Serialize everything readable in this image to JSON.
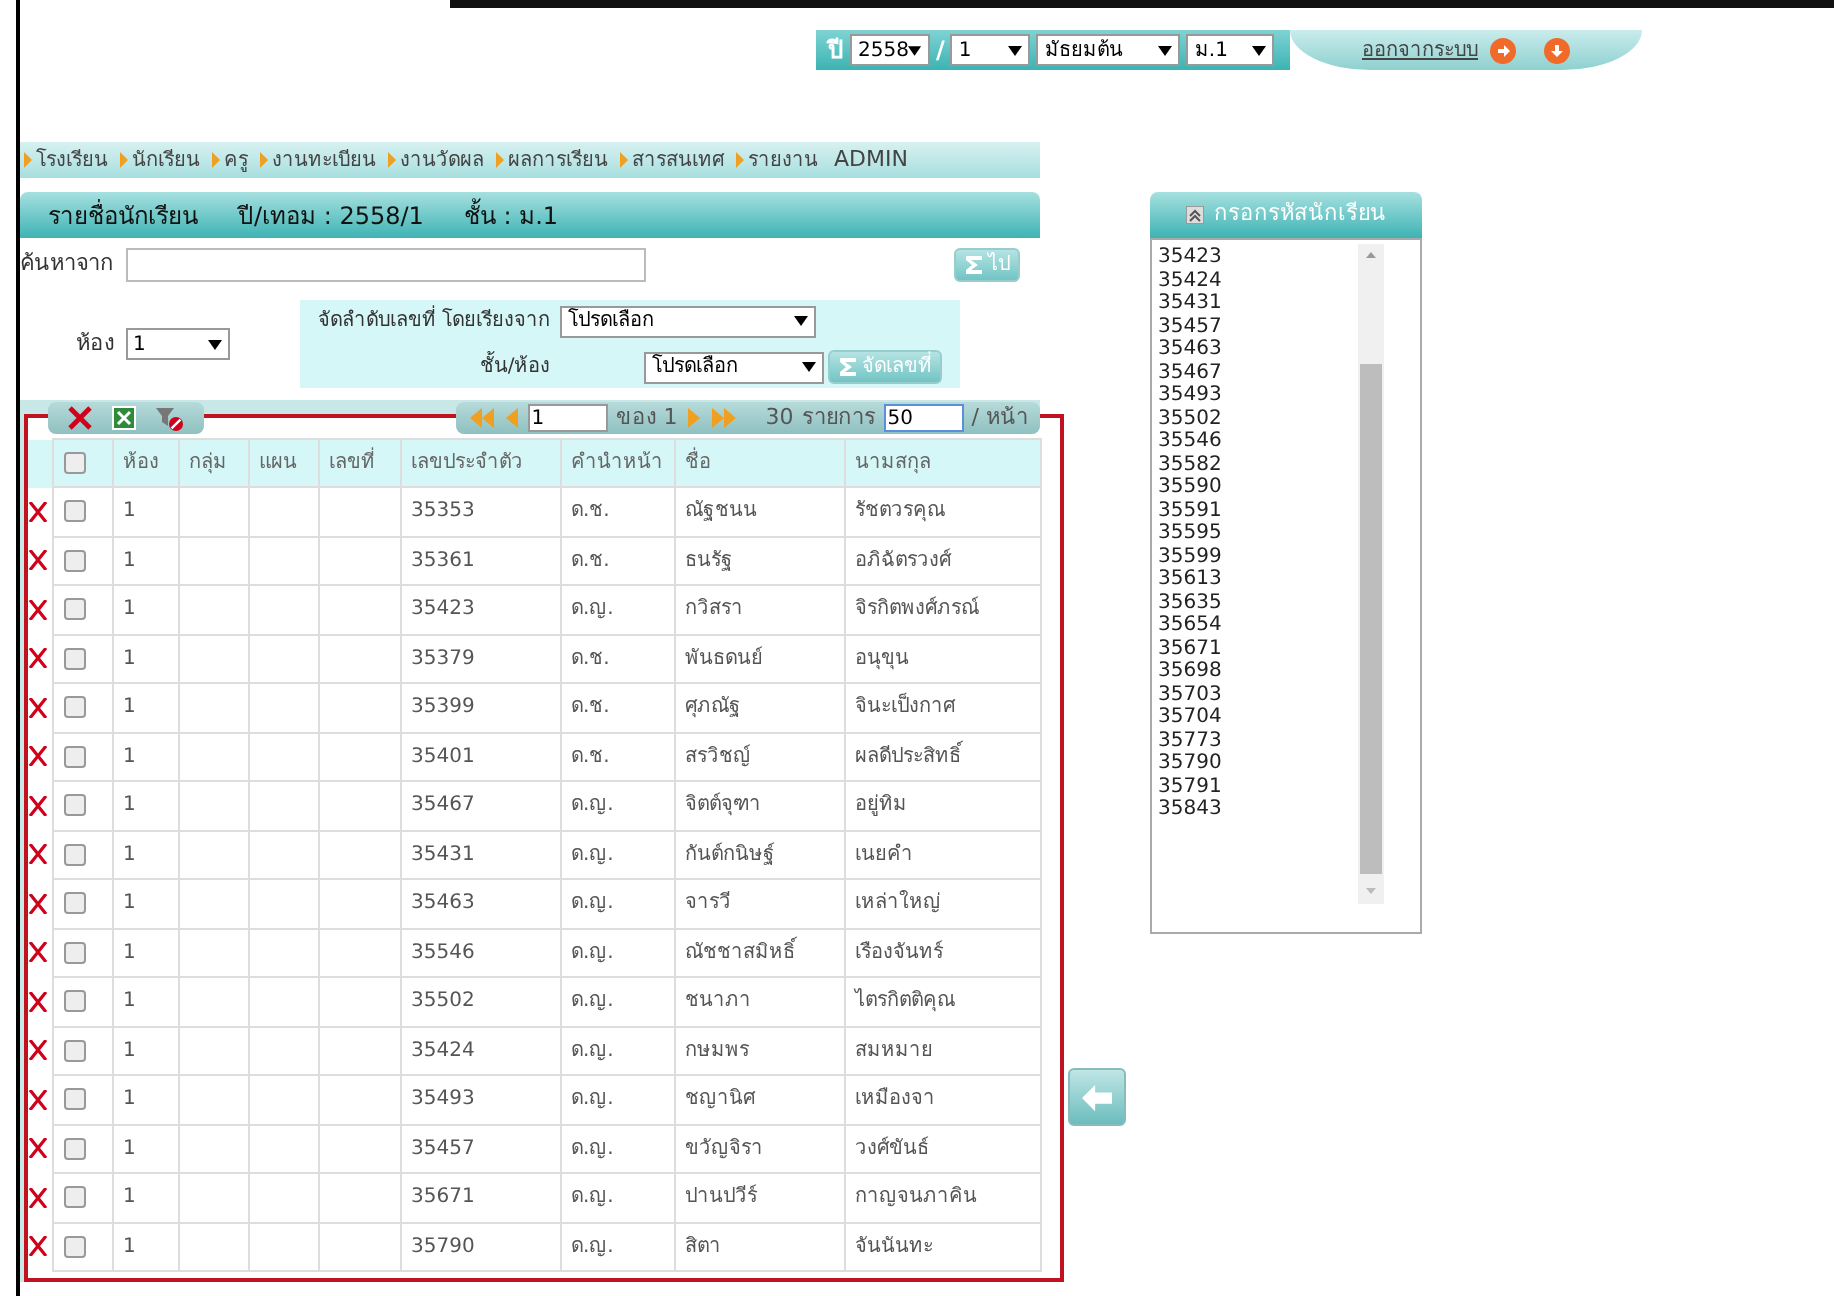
{
  "top_bar": {
    "year_label": "ปี",
    "separator": "/",
    "selects": [
      {
        "value": "2558"
      },
      {
        "value": "1"
      },
      {
        "value": "มัธยมต้น"
      },
      {
        "value": "ม.1"
      }
    ],
    "logout_link": "ออกจากระบบ"
  },
  "menu": [
    {
      "label": "โรงเรียน",
      "kind": "arrow"
    },
    {
      "label": "นักเรียน",
      "kind": "arrow"
    },
    {
      "label": "ครู",
      "kind": "arrow"
    },
    {
      "label": "งานทะเบียน",
      "kind": "arrow"
    },
    {
      "label": "งานวัดผล",
      "kind": "arrow"
    },
    {
      "label": "ผลการเรียน",
      "kind": "arrow"
    },
    {
      "label": "สารสนเทศ",
      "kind": "arrow"
    },
    {
      "label": "รายงาน",
      "kind": "arrow"
    },
    {
      "label": "ADMIN",
      "kind": "plain"
    }
  ],
  "panel_title": [
    "รายชื่อนักเรียน",
    "ปี/เทอม  :  2558/1",
    "ชั้น  :  ม.1"
  ],
  "search": {
    "label": "ค้นหาจาก",
    "button": "ไป"
  },
  "room": {
    "label": "ห้อง",
    "value": "1"
  },
  "sort": {
    "label": "จัดลำดับเลขที่  โดยเรียงจาก",
    "select": "โปรดเลือก",
    "label2": "ชั้น/ห้อง",
    "select2": "โปรดเลือก",
    "button": "จัดเลขที่"
  },
  "pager": {
    "page": "1",
    "of_label": "ของ",
    "total_pages": "1",
    "count": "30",
    "items_label": "รายการ",
    "per_page": "50",
    "per_page_label": "/ หน้า"
  },
  "table": {
    "all_checked": false,
    "columns": [
      "ห้อง",
      "กลุ่ม",
      "แผน",
      "เลขที่",
      "เลขประจำตัว",
      "คำนำหน้า",
      "ชื่อ",
      "นามสกุล"
    ],
    "rows": [
      {
        "checked": false,
        "cells": [
          "1",
          "",
          "",
          "",
          "35353",
          "ด.ช.",
          "ณัฐชนน",
          "รัชตวรคุณ"
        ]
      },
      {
        "checked": false,
        "cells": [
          "1",
          "",
          "",
          "",
          "35361",
          "ด.ช.",
          "ธนรัฐ",
          "อภิฉัตรวงศ์"
        ]
      },
      {
        "checked": false,
        "cells": [
          "1",
          "",
          "",
          "",
          "35423",
          "ด.ญ.",
          "กวิสรา",
          "จิรกิตพงศ์ภรณ์"
        ]
      },
      {
        "checked": false,
        "cells": [
          "1",
          "",
          "",
          "",
          "35379",
          "ด.ช.",
          "พันธดนย์",
          "อนุขุน"
        ]
      },
      {
        "checked": false,
        "cells": [
          "1",
          "",
          "",
          "",
          "35399",
          "ด.ช.",
          "ศุภณัฐ",
          "จินะเป็งกาศ"
        ]
      },
      {
        "checked": false,
        "cells": [
          "1",
          "",
          "",
          "",
          "35401",
          "ด.ช.",
          "สรวิชญ์",
          "ผลดีประสิทธิ์"
        ]
      },
      {
        "checked": false,
        "cells": [
          "1",
          "",
          "",
          "",
          "35467",
          "ด.ญ.",
          "จิตต์จุฑา",
          "อยู่ทิม"
        ]
      },
      {
        "checked": false,
        "cells": [
          "1",
          "",
          "",
          "",
          "35431",
          "ด.ญ.",
          "กันต์กนิษฐ์",
          "เนยคำ"
        ]
      },
      {
        "checked": false,
        "cells": [
          "1",
          "",
          "",
          "",
          "35463",
          "ด.ญ.",
          "จารวี",
          "เหล่าใหญ่"
        ]
      },
      {
        "checked": false,
        "cells": [
          "1",
          "",
          "",
          "",
          "35546",
          "ด.ญ.",
          "ณัชชาสมิหธิ์",
          "เรืองจันทร์"
        ]
      },
      {
        "checked": false,
        "cells": [
          "1",
          "",
          "",
          "",
          "35502",
          "ด.ญ.",
          "ชนาภา",
          "ไตรกิตติคุณ"
        ]
      },
      {
        "checked": false,
        "cells": [
          "1",
          "",
          "",
          "",
          "35424",
          "ด.ญ.",
          "กษมพร",
          "สมหมาย"
        ]
      },
      {
        "checked": false,
        "cells": [
          "1",
          "",
          "",
          "",
          "35493",
          "ด.ญ.",
          "ชญานิศ",
          "เหมืองจา"
        ]
      },
      {
        "checked": false,
        "cells": [
          "1",
          "",
          "",
          "",
          "35457",
          "ด.ญ.",
          "ขวัญจิรา",
          "วงศ์ขันธ์"
        ]
      },
      {
        "checked": false,
        "cells": [
          "1",
          "",
          "",
          "",
          "35671",
          "ด.ญ.",
          "ปานปวีร์",
          "กาญจนภาคิน"
        ]
      },
      {
        "checked": false,
        "cells": [
          "1",
          "",
          "",
          "",
          "35790",
          "ด.ญ.",
          "สิตา",
          "จันนันทะ"
        ]
      }
    ]
  },
  "side_panel": {
    "title": "กรอกรหัสนักเรียน",
    "ids": [
      "35423",
      "35424",
      "35431",
      "35457",
      "35463",
      "35467",
      "35493",
      "35502",
      "35546",
      "35582",
      "35590",
      "35591",
      "35595",
      "35599",
      "35613",
      "35635",
      "35654",
      "35671",
      "35698",
      "35703",
      "35704",
      "35773",
      "35790",
      "35791",
      "35843"
    ]
  }
}
